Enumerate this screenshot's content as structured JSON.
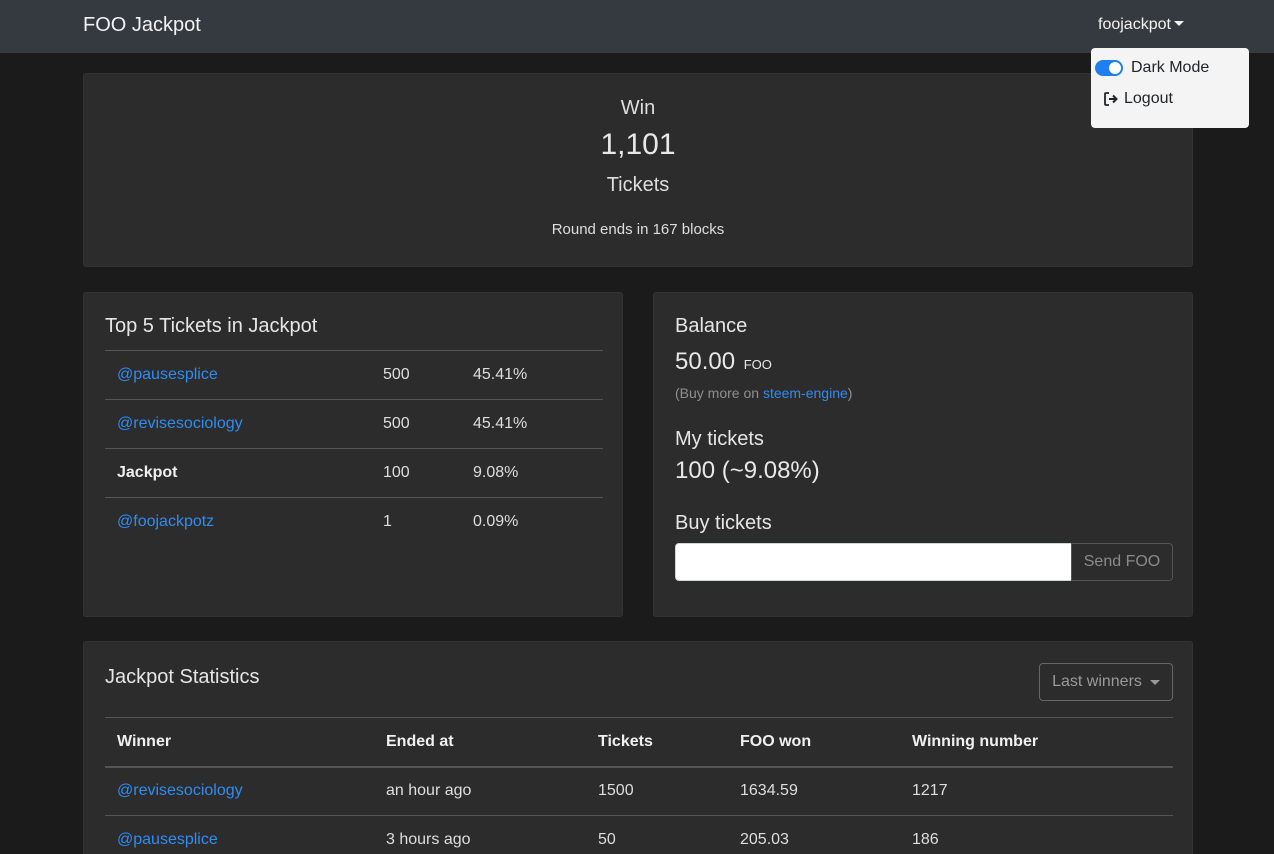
{
  "navbar": {
    "brand": "FOO Jackpot",
    "user": "foojackpot"
  },
  "dropdown": {
    "dark_mode": "Dark Mode",
    "logout": "Logout"
  },
  "hero": {
    "win": "Win",
    "amount": "1,101",
    "unit": "Tickets",
    "round": "Round ends in 167 blocks"
  },
  "top5": {
    "title": "Top 5 Tickets in Jackpot",
    "rows": [
      {
        "name": "@pausesplice",
        "tickets": "500",
        "share": "45.41%"
      },
      {
        "name": "@revisesociology",
        "tickets": "500",
        "share": "45.41%"
      },
      {
        "name": "Jackpot",
        "tickets": "100",
        "share": "9.08%"
      },
      {
        "name": "@foojackpotz",
        "tickets": "1",
        "share": "0.09%"
      }
    ]
  },
  "balance": {
    "title": "Balance",
    "value": "50.00",
    "currency": "FOO",
    "buy_more_prefix": "(Buy more on ",
    "buy_more_link": "steem-engine",
    "buy_more_suffix": ")",
    "my_tickets_title": "My tickets",
    "my_tickets_value": "100 (~9.08%)",
    "buy_title": "Buy tickets",
    "send_label": "Send FOO"
  },
  "stats": {
    "title": "Jackpot Statistics",
    "filter_label": "Last winners",
    "columns": [
      "Winner",
      "Ended at",
      "Tickets",
      "FOO won",
      "Winning number"
    ],
    "rows": [
      {
        "winner": "@revisesociology",
        "ended": "an hour ago",
        "tickets": "1500",
        "won": "1634.59",
        "number": "1217"
      },
      {
        "winner": "@pausesplice",
        "ended": "3 hours ago",
        "tickets": "50",
        "won": "205.03",
        "number": "186"
      }
    ]
  }
}
